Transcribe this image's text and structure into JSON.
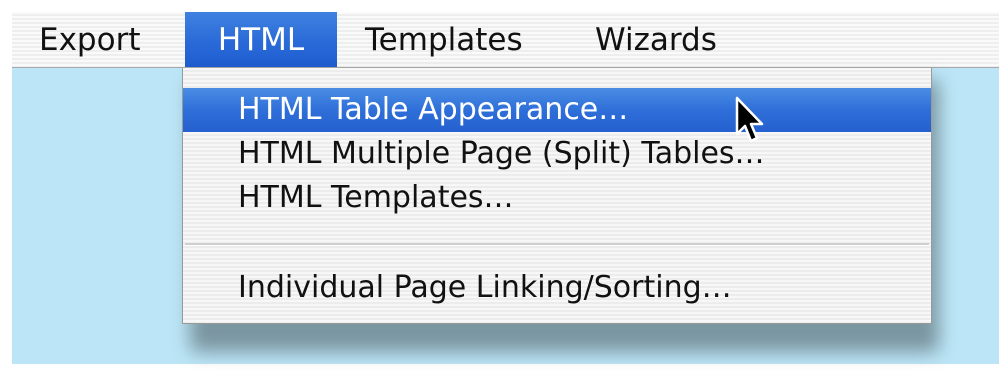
{
  "menubar": {
    "items": [
      {
        "label": "Export"
      },
      {
        "label": "HTML"
      },
      {
        "label": "Templates"
      },
      {
        "label": "Wizards"
      }
    ],
    "active": "HTML"
  },
  "dropdown": {
    "items": [
      {
        "label": "HTML Table Appearance…",
        "highlighted": true
      },
      {
        "label": "HTML Multiple Page (Split) Tables…"
      },
      {
        "label": "HTML Templates…"
      },
      {
        "label": "Individual Page Linking/Sorting…"
      }
    ]
  },
  "cursor": {
    "icon": "arrow-pointer-icon"
  },
  "colors": {
    "accent": "#2a6ad8",
    "desktop": "#bce6f7",
    "menu_background": "#f2f2f2"
  }
}
